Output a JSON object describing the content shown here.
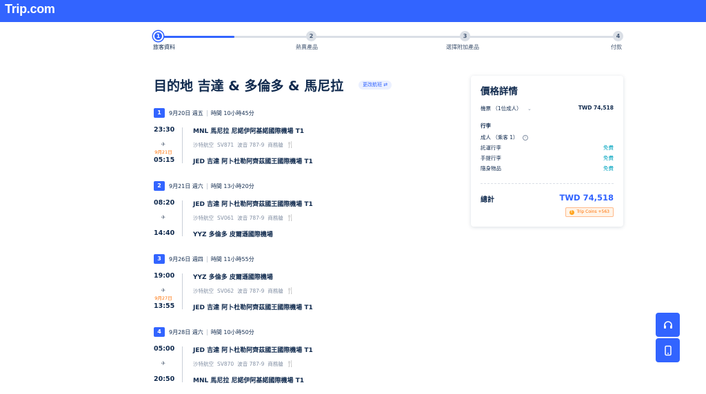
{
  "header": {
    "logo": "Trip.com"
  },
  "stepper": {
    "steps": [
      {
        "num": "1",
        "label": "旅客資料"
      },
      {
        "num": "2",
        "label": "熱賣產品"
      },
      {
        "num": "3",
        "label": "選擇附加產品"
      },
      {
        "num": "4",
        "label": "付款"
      }
    ]
  },
  "trip": {
    "title": "目的地 吉達 & 多倫多 & 馬尼拉",
    "change_label": "更改航班"
  },
  "segments": [
    {
      "num": "1",
      "date": "9月20日 週五",
      "duration": "時間 10小時45分",
      "dep_time": "23:30",
      "dep_airport": "MNL 馬尼拉 尼諾伊阿基諾國際機場 T1",
      "airline": "沙特航空",
      "flight": "SV871",
      "aircraft": "波音 787-9",
      "cabin": "商務艙",
      "arr_note": "9月21日",
      "arr_time": "05:15",
      "arr_airport": "JED 吉達 阿卜杜勒阿齊茲國王國際機場 T1"
    },
    {
      "num": "2",
      "date": "9月21日 週六",
      "duration": "時間 13小時20分",
      "dep_time": "08:20",
      "dep_airport": "JED 吉達 阿卜杜勒阿齊茲國王國際機場 T1",
      "airline": "沙特航空",
      "flight": "SV061",
      "aircraft": "波音 787-9",
      "cabin": "商務艙",
      "arr_note": "",
      "arr_time": "14:40",
      "arr_airport": "YYZ 多倫多 皮爾遜國際機場"
    },
    {
      "num": "3",
      "date": "9月26日 週四",
      "duration": "時間 11小時55分",
      "dep_time": "19:00",
      "dep_airport": "YYZ 多倫多 皮爾遜國際機場",
      "airline": "沙特航空",
      "flight": "SV062",
      "aircraft": "波音 787-9",
      "cabin": "商務艙",
      "arr_note": "9月27日",
      "arr_time": "13:55",
      "arr_airport": "JED 吉達 阿卜杜勒阿齊茲國王國際機場 T1"
    },
    {
      "num": "4",
      "date": "9月28日 週六",
      "duration": "時間 10小時50分",
      "dep_time": "05:00",
      "dep_airport": "JED 吉達 阿卜杜勒阿齊茲國王國際機場 T1",
      "airline": "沙特航空",
      "flight": "SV870",
      "aircraft": "波音 787-9",
      "cabin": "商務艙",
      "arr_note": "",
      "arr_time": "20:50",
      "arr_airport": "MNL 馬尼拉 尼諾伊阿基諾國際機場 T1"
    }
  ],
  "price": {
    "title": "價格詳情",
    "ticket_label": "機票 （1位成人）",
    "ticket_value": "TWD 74,518",
    "baggage_heading": "行李",
    "adult_label": "成人 （乘客 1）",
    "checked_label": "託運行李",
    "checked_value": "免費",
    "carryon_label": "手提行李",
    "carryon_value": "免費",
    "personal_label": "隨身物品",
    "personal_value": "免費",
    "total_label": "總計",
    "total_value": "TWD 74,518",
    "coins": "Trip Coins +563"
  },
  "colors": {
    "brand": "#3264ff",
    "free": "#00a4bf",
    "next_day": "#ff6f00"
  },
  "icons": {
    "support": "headset-icon",
    "app": "mobile-phone-icon"
  }
}
